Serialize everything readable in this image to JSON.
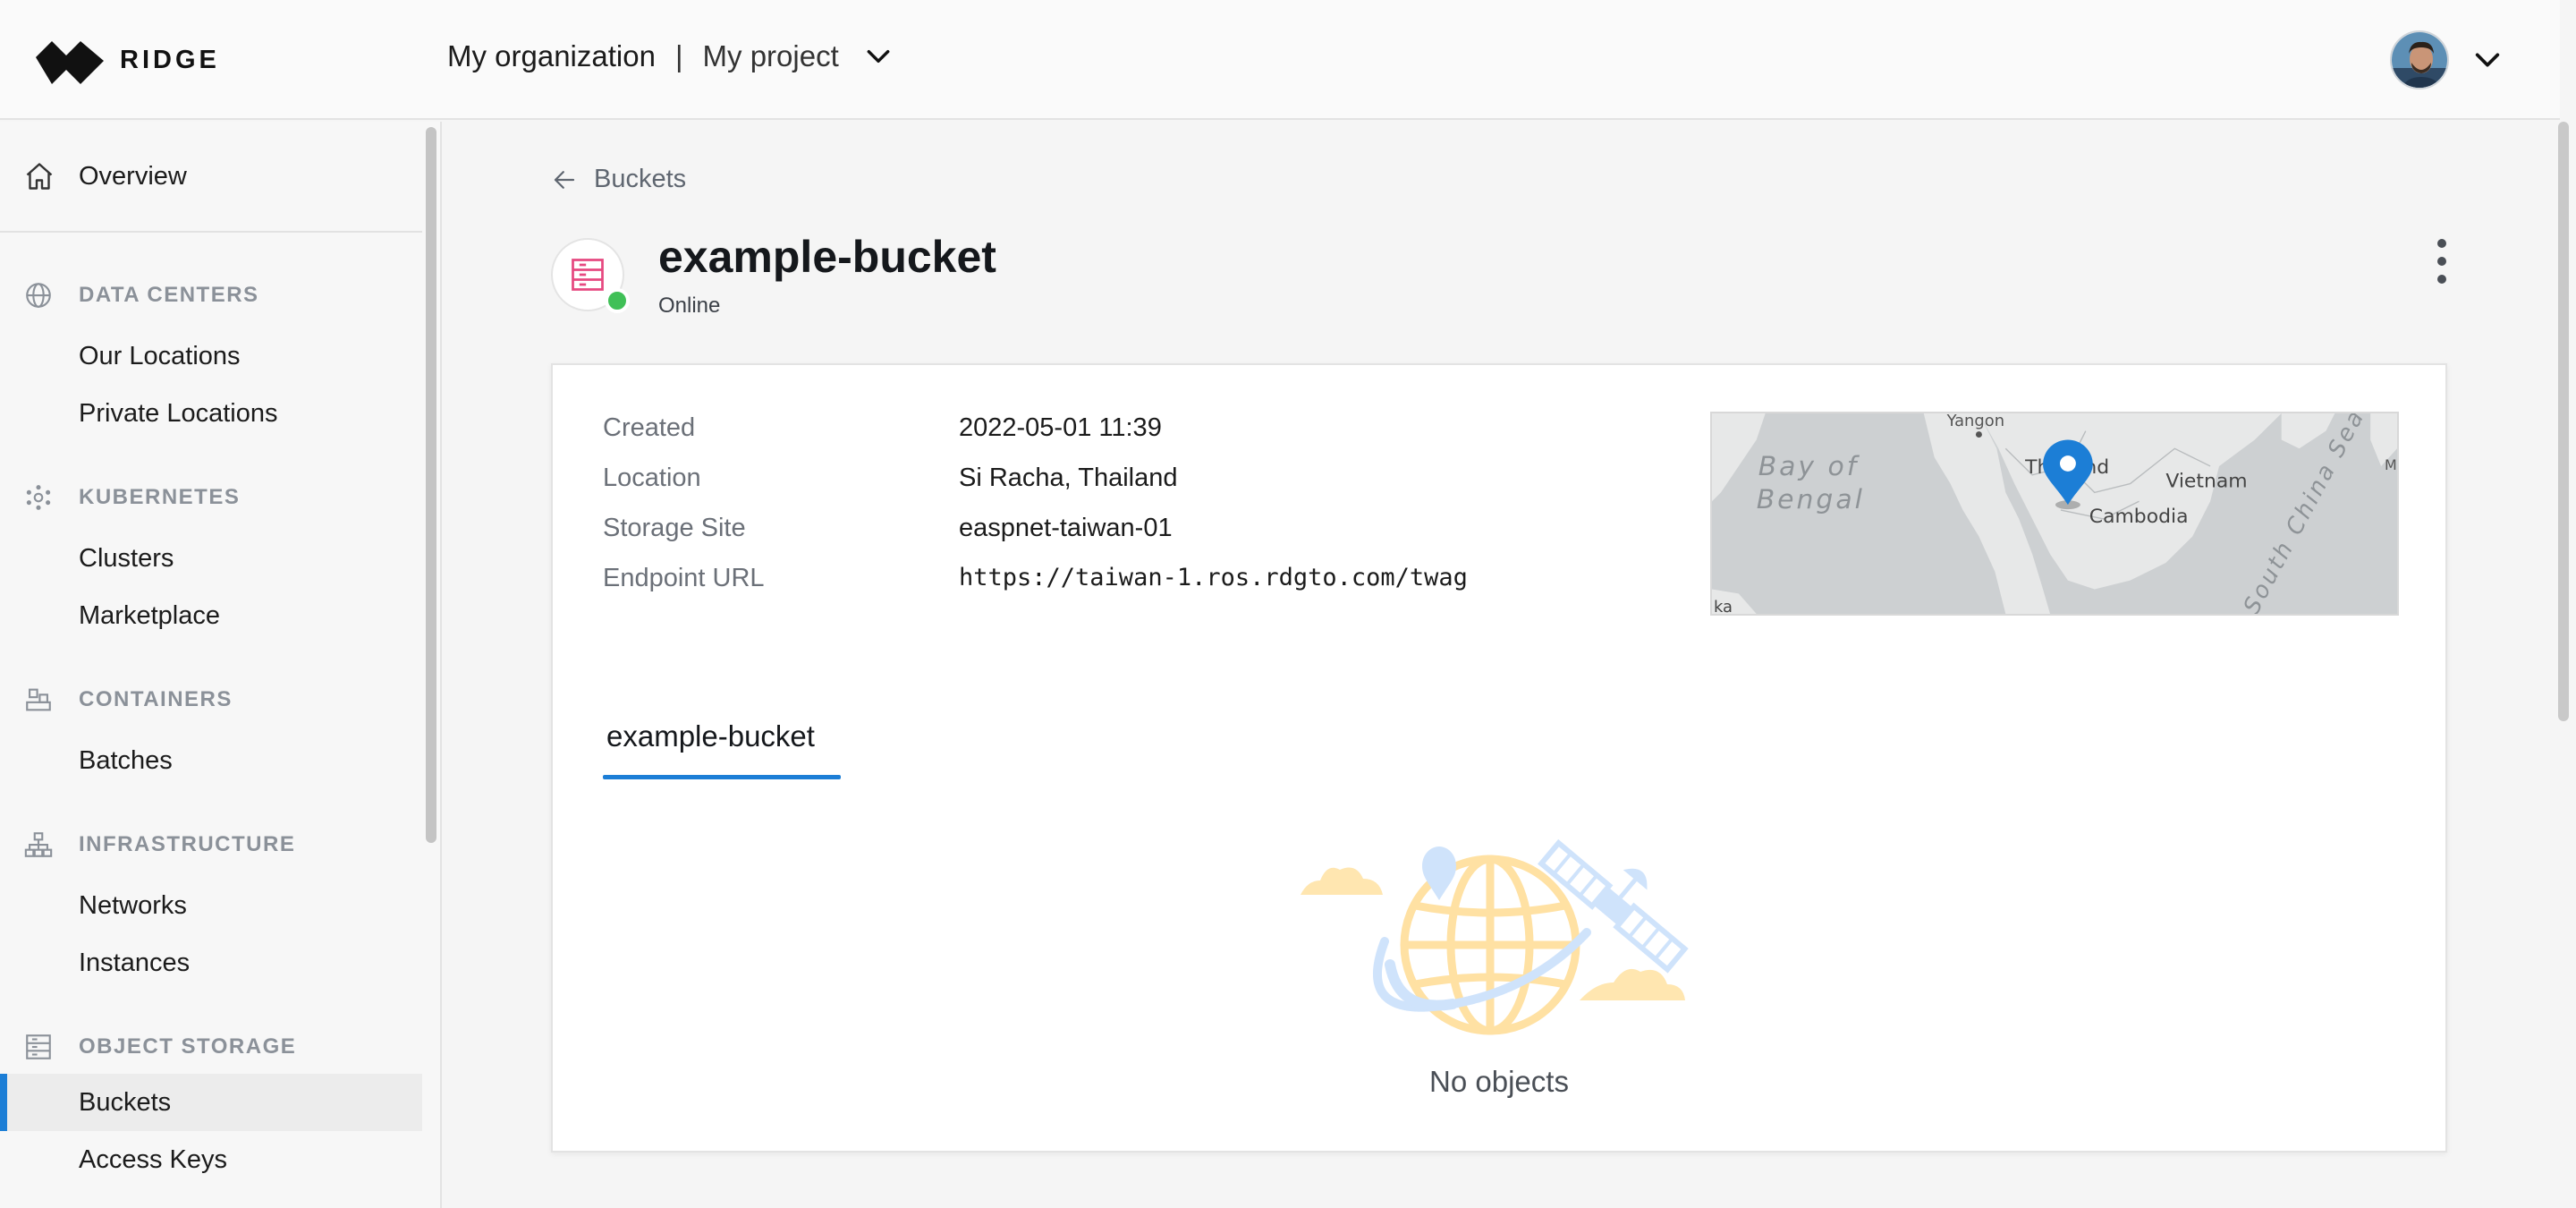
{
  "brand": {
    "name": "RIDGE",
    "logo_icon": "ridge-logo-icon"
  },
  "header": {
    "organization": "My organization",
    "separator": "|",
    "project": "My project",
    "project_dropdown_icon": "chevron-down-icon",
    "user_menu_icon": "chevron-down-icon"
  },
  "sidebar": {
    "overview": {
      "label": "Overview",
      "icon": "home-icon"
    },
    "sections": [
      {
        "title": "DATA CENTERS",
        "icon": "globe-icon",
        "items": [
          {
            "label": "Our Locations"
          },
          {
            "label": "Private Locations"
          }
        ]
      },
      {
        "title": "KUBERNETES",
        "icon": "kubernetes-icon",
        "items": [
          {
            "label": "Clusters"
          },
          {
            "label": "Marketplace"
          }
        ]
      },
      {
        "title": "CONTAINERS",
        "icon": "containers-icon",
        "items": [
          {
            "label": "Batches"
          }
        ]
      },
      {
        "title": "INFRASTRUCTURE",
        "icon": "network-icon",
        "items": [
          {
            "label": "Networks"
          },
          {
            "label": "Instances"
          }
        ]
      },
      {
        "title": "OBJECT STORAGE",
        "icon": "storage-icon",
        "items": [
          {
            "label": "Buckets",
            "active": true
          },
          {
            "label": "Access Keys"
          }
        ]
      }
    ]
  },
  "main": {
    "back_label": "Buckets",
    "title": "example-bucket",
    "status": "Online",
    "status_color": "#40c057",
    "details": {
      "created_label": "Created",
      "created_value": "2022-05-01 11:39",
      "location_label": "Location",
      "location_value": "Si Racha, Thailand",
      "storage_site_label": "Storage Site",
      "storage_site_value": "easpnet-taiwan-01",
      "endpoint_label": "Endpoint URL",
      "endpoint_value": "https://taiwan-1.ros.rdgto.com/twag"
    },
    "map": {
      "labels": {
        "bay_1": "Bay of",
        "bay_2": "Bengal",
        "yangon": "Yangon",
        "thailand": "Thailand",
        "vietnam": "Vietnam",
        "cambodia": "Cambodia",
        "south_china_sea": "South China Sea",
        "edge_left": "ka",
        "edge_right": "M"
      }
    },
    "tab_label": "example-bucket",
    "empty_text": "No objects"
  },
  "colors": {
    "accent": "#1c7ed6",
    "online": "#40c057",
    "bucket_icon": "#e64980"
  }
}
